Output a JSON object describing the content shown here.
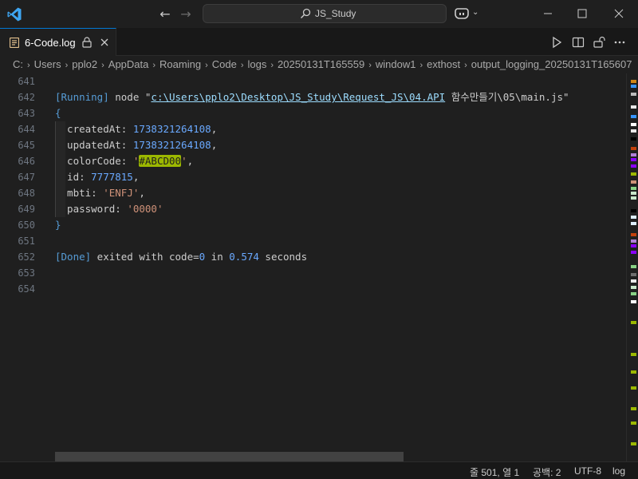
{
  "window": {
    "command_center_text": "JS_Study"
  },
  "tab": {
    "label": "6-Code.log"
  },
  "breadcrumb": {
    "items": [
      "C:",
      "Users",
      "pplo2",
      "AppData",
      "Roaming",
      "Code",
      "logs",
      "20250131T165559",
      "window1",
      "exthost",
      "output_logging_20250131T165607"
    ]
  },
  "editor": {
    "line_numbers": [
      "641",
      "642",
      "643",
      "644",
      "645",
      "646",
      "647",
      "648",
      "649",
      "650",
      "651",
      "652",
      "653",
      "654"
    ],
    "running_tag": "[Running]",
    "running_cmd": " node \"",
    "running_path": "c:\\Users\\pplo2\\Desktop\\JS_Study\\Request_JS\\04.API",
    "running_path_tail": " 함수만들기\\05\\main.js\"",
    "open_brace": "{",
    "fields": [
      {
        "key": "  createdAt: ",
        "value": "1738321264108",
        "suffix": ","
      },
      {
        "key": "  updatedAt: ",
        "value": "1738321264108",
        "suffix": ","
      },
      {
        "key": "  colorCode: ",
        "value_open": "'",
        "value": "#ABCD00",
        "value_close": "'",
        "suffix": ","
      },
      {
        "key": "  id: ",
        "value": "7777815",
        "suffix": ","
      },
      {
        "key": "  mbti: ",
        "value": "'ENFJ'",
        "suffix": ","
      },
      {
        "key": "  password: ",
        "value": "'0000'",
        "suffix": ""
      }
    ],
    "close_brace": "}",
    "done_tag": "[Done]",
    "done_text_1": " exited with code=",
    "done_code": "0",
    "done_text_2": " in ",
    "done_seconds": "0.574",
    "done_text_3": " seconds"
  },
  "statusbar": {
    "position": "줄 501, 열 1",
    "spaces": "공백: 2",
    "encoding": "UTF-8",
    "language": "log"
  },
  "colors": {
    "accent": "#0078d4",
    "color_swatch": "#9cb800",
    "number": "#6aa9ff",
    "string": "#ce9178",
    "keyword": "#569cd6"
  }
}
